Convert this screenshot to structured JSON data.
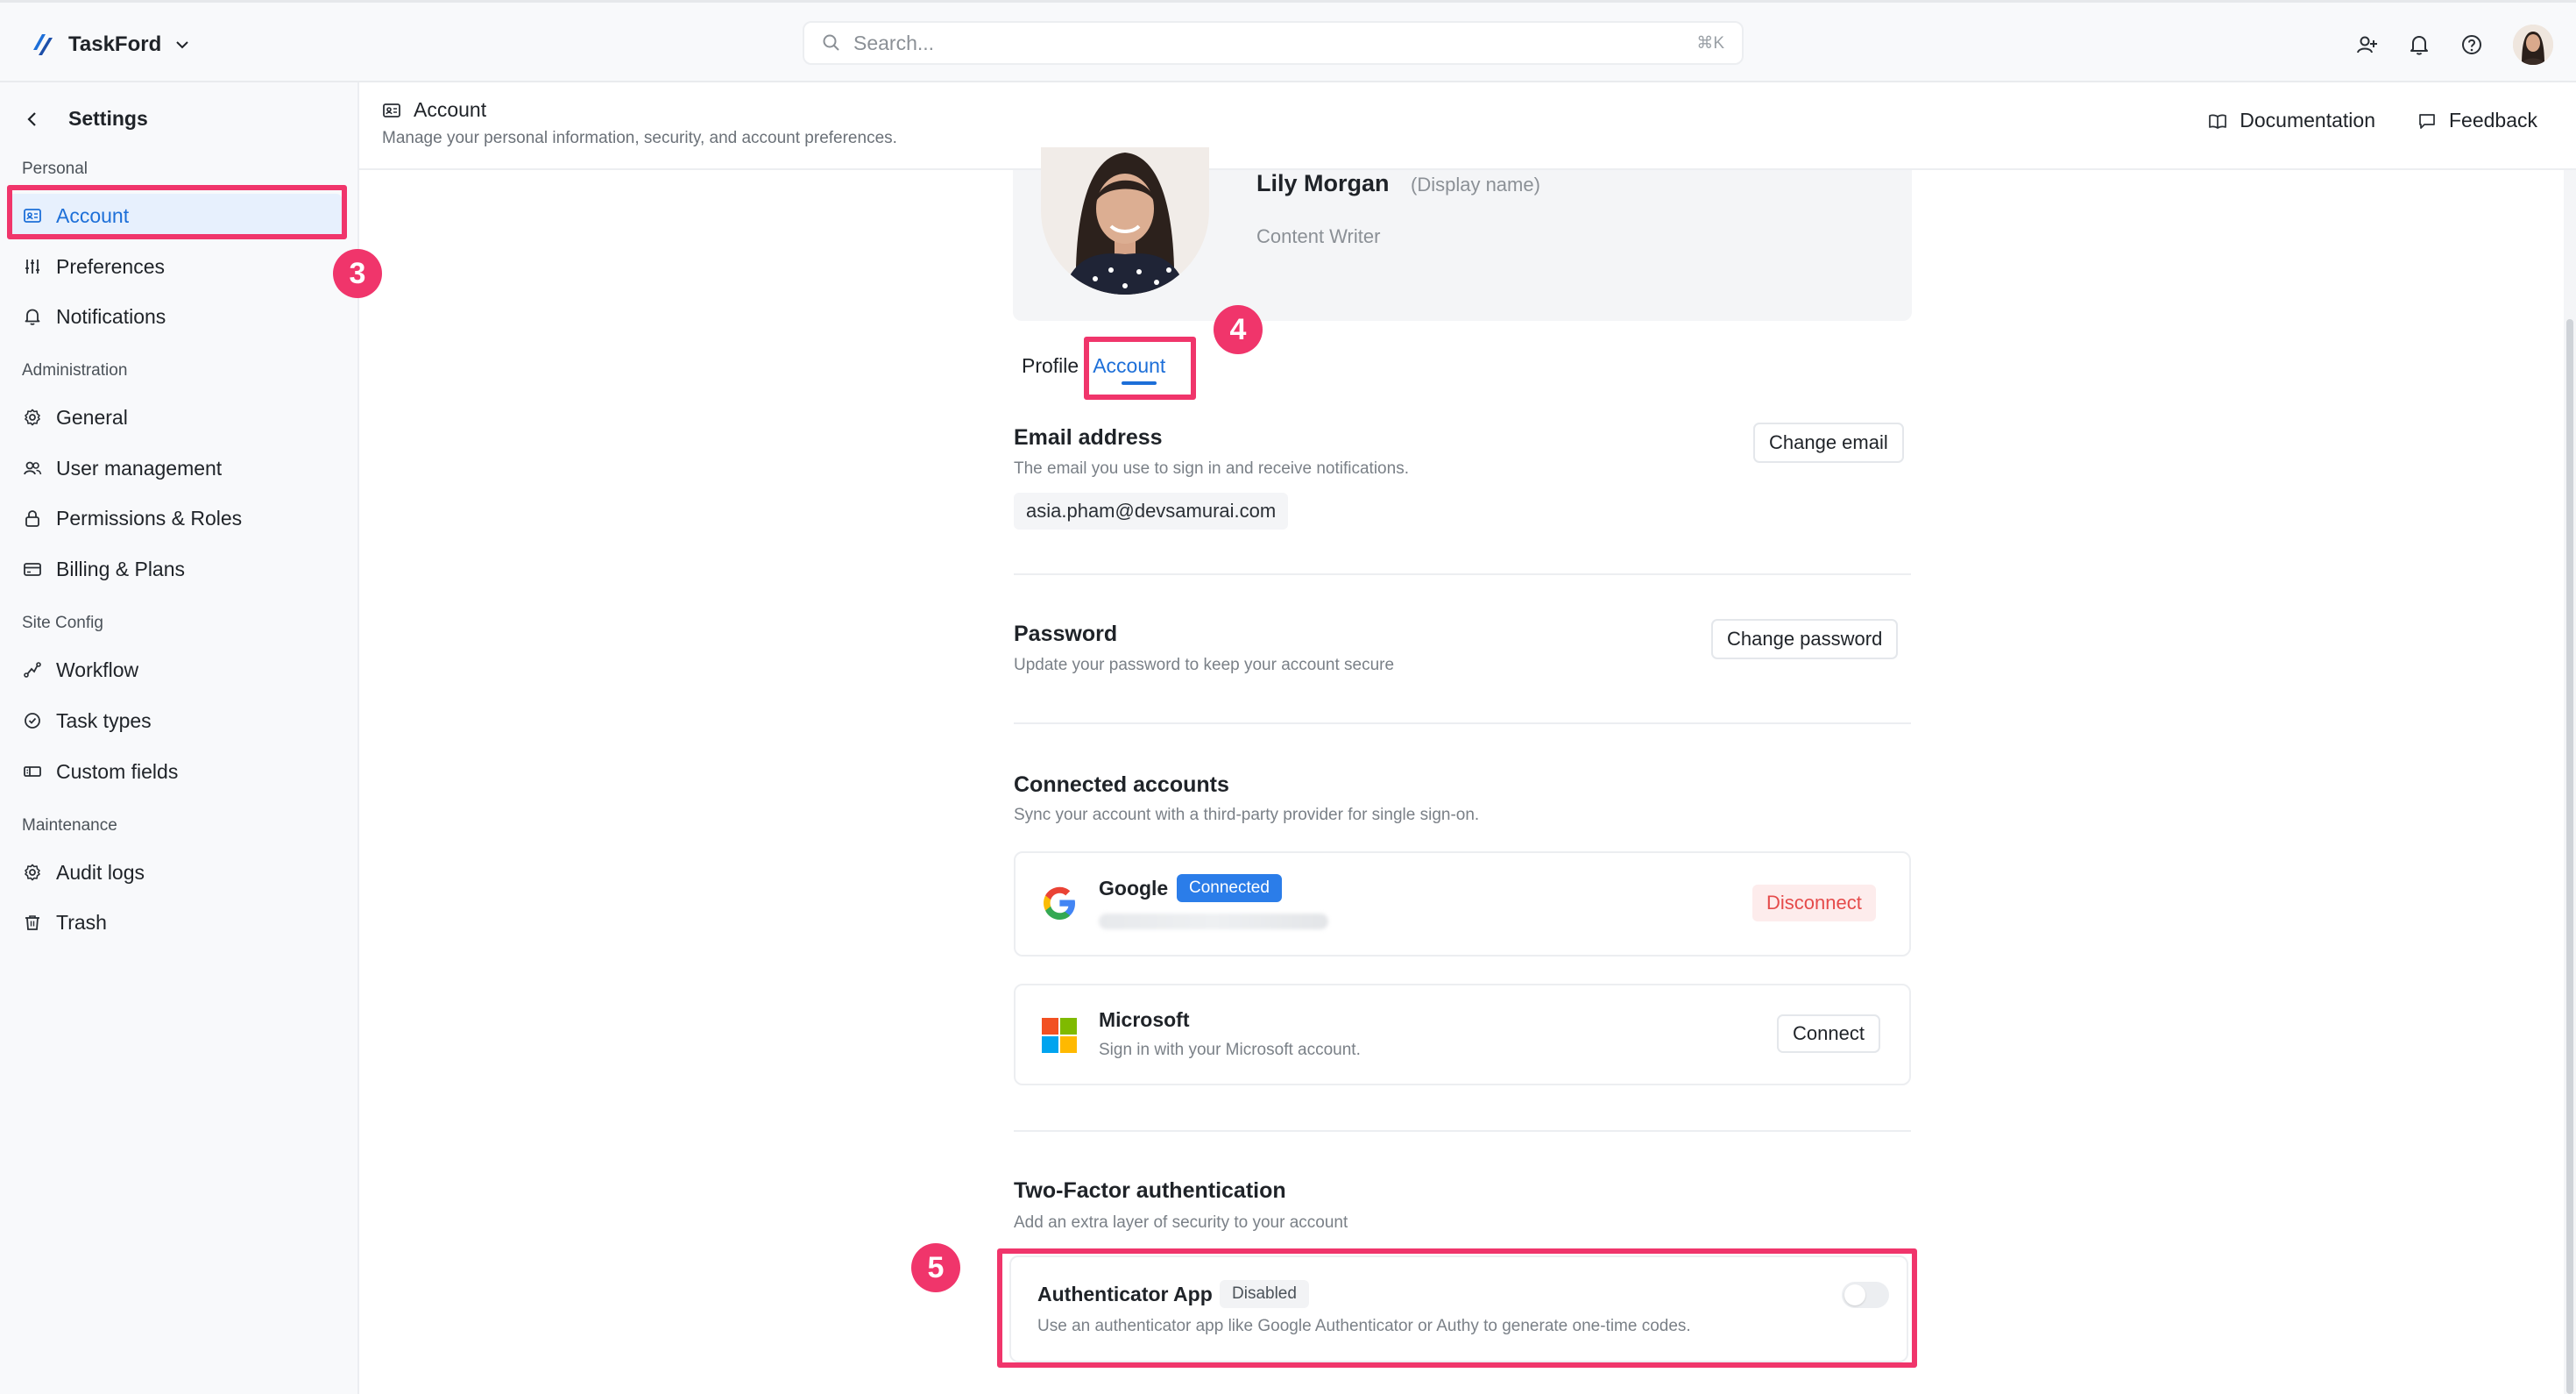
{
  "app": {
    "name": "TaskFord",
    "search_placeholder": "Search...",
    "search_shortcut": "⌘K"
  },
  "header_icons": [
    "add-user-icon",
    "bell-icon",
    "help-icon",
    "avatar"
  ],
  "sidebar": {
    "title": "Settings",
    "sections": {
      "personal": "Personal",
      "administration": "Administration",
      "site_config": "Site Config",
      "maintenance": "Maintenance"
    },
    "items": {
      "account": "Account",
      "preferences": "Preferences",
      "notifications": "Notifications",
      "general": "General",
      "user_management": "User management",
      "permissions_roles": "Permissions & Roles",
      "billing_plans": "Billing & Plans",
      "workflow": "Workflow",
      "task_types": "Task types",
      "custom_fields": "Custom fields",
      "audit_logs": "Audit logs",
      "trash": "Trash"
    }
  },
  "page": {
    "title": "Account",
    "subtitle": "Manage your personal information, security, and account preferences.",
    "links": {
      "documentation": "Documentation",
      "feedback": "Feedback"
    }
  },
  "profile": {
    "name": "Lily Morgan",
    "display_hint": "(Display name)",
    "role": "Content Writer"
  },
  "tabs": {
    "profile": "Profile",
    "account": "Account"
  },
  "email": {
    "title": "Email address",
    "desc": "The email you use to sign in and receive notifications.",
    "value": "asia.pham@devsamurai.com",
    "button": "Change email"
  },
  "password": {
    "title": "Password",
    "desc": "Update your password to keep your account secure",
    "button": "Change password"
  },
  "connected": {
    "title": "Connected accounts",
    "desc": "Sync your account with a third-party provider for single sign-on.",
    "google": {
      "name": "Google",
      "status": "Connected",
      "button": "Disconnect"
    },
    "microsoft": {
      "name": "Microsoft",
      "desc": "Sign in with your Microsoft account.",
      "button": "Connect"
    }
  },
  "tfa": {
    "title": "Two-Factor authentication",
    "desc": "Add an extra layer of security to your account",
    "app_name": "Authenticator App",
    "status": "Disabled",
    "app_desc": "Use an authenticator app like Google Authenticator or Authy to generate one-time codes.",
    "enabled": false
  },
  "annotations": {
    "step3": "3",
    "step4": "4",
    "step5": "5"
  },
  "colors": {
    "accent": "#1d6fd8",
    "highlight": "#f0356b",
    "danger": "#e54b4b",
    "badge": "#2b7de9"
  }
}
